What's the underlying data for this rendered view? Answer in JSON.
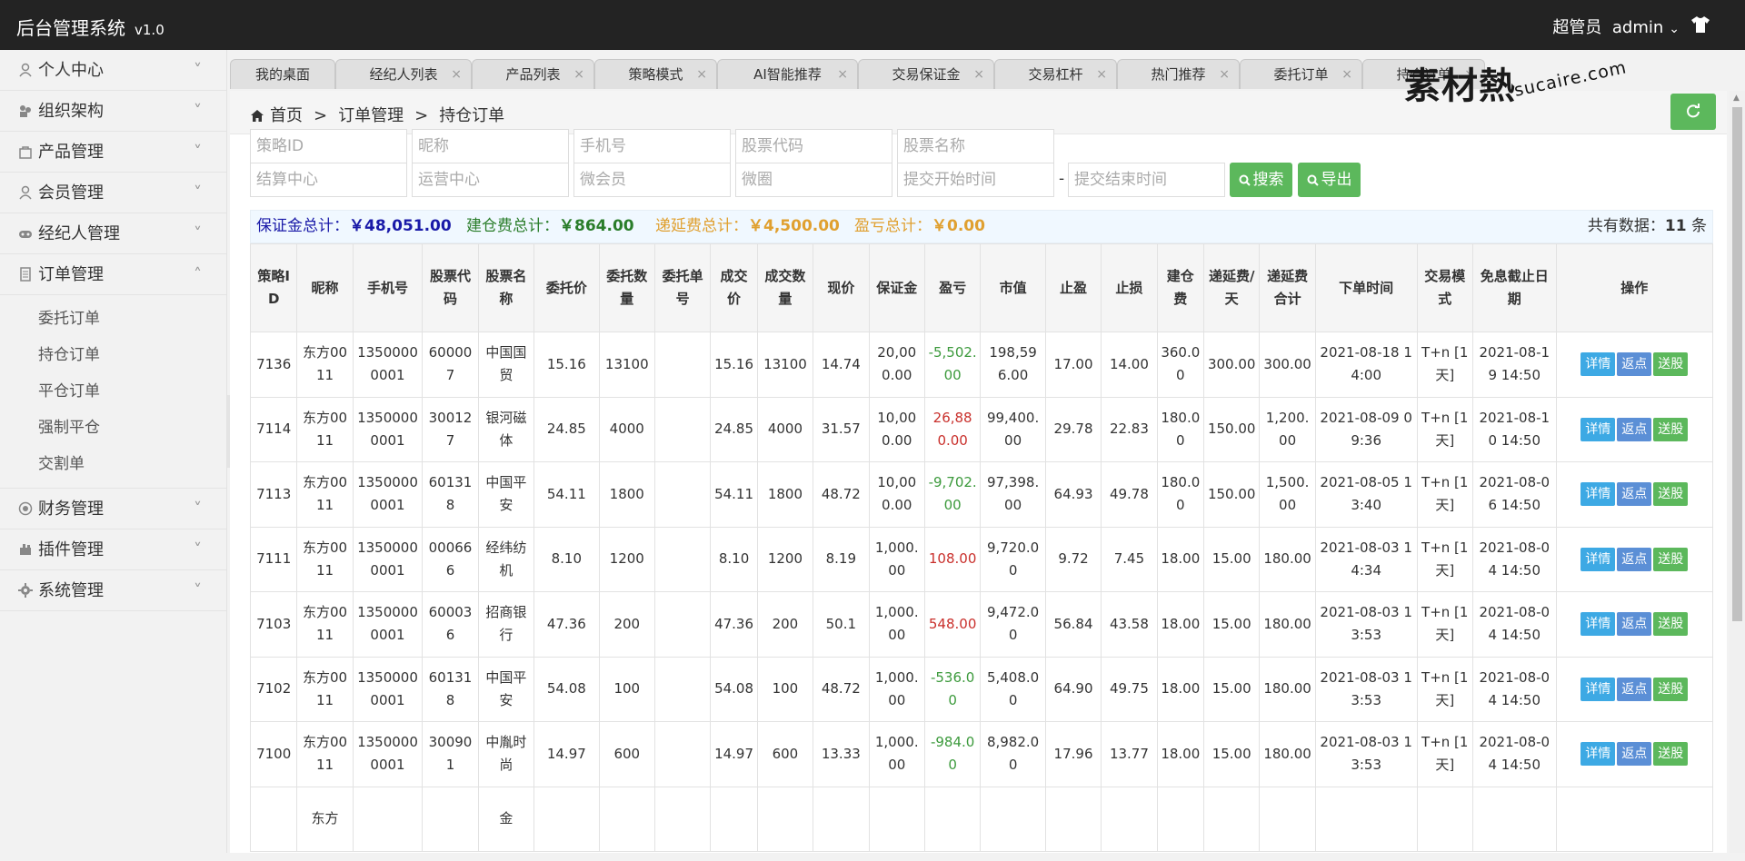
{
  "header": {
    "app_title": "后台管理系统",
    "version": "v1.0",
    "role": "超管员",
    "username": "admin"
  },
  "sidebar": {
    "items_top": [
      {
        "label": "个人中心",
        "icon": "user-icon"
      },
      {
        "label": "组织架构",
        "icon": "org-icon"
      },
      {
        "label": "产品管理",
        "icon": "bag-icon"
      },
      {
        "label": "会员管理",
        "icon": "member-icon"
      },
      {
        "label": "经纪人管理",
        "icon": "gamepad-icon"
      },
      {
        "label": "订单管理",
        "icon": "document-icon"
      }
    ],
    "sub_items": [
      "委托订单",
      "持仓订单",
      "平仓订单",
      "强制平仓",
      "交割单"
    ],
    "items_bottom": [
      {
        "label": "财务管理",
        "icon": "finance-icon"
      },
      {
        "label": "插件管理",
        "icon": "plugin-icon"
      },
      {
        "label": "系统管理",
        "icon": "gear-icon"
      }
    ]
  },
  "tabs": [
    "我的桌面",
    "经纪人列表",
    "产品列表",
    "策略模式",
    "AI智能推荐",
    "交易保证金",
    "交易杠杆",
    "热门推荐",
    "委托订单",
    "持仓订单"
  ],
  "watermark": {
    "big": "素材熱",
    "small": "sucaire.com"
  },
  "breadcrumb": {
    "home": "首页",
    "sep": ">",
    "level1": "订单管理",
    "level2": "持仓订单"
  },
  "filters": {
    "strategy_id": "策略ID",
    "nickname": "昵称",
    "phone": "手机号",
    "stock_code": "股票代码",
    "stock_name": "股票名称",
    "settle_center": "结算中心",
    "ops_center": "运营中心",
    "micro_member": "微会员",
    "micro_circle": "微圈",
    "start_time": "提交开始时间",
    "end_time": "提交结束时间",
    "dash": "-",
    "search_label": "搜索",
    "export_label": "导出"
  },
  "summary": {
    "margin_label": "保证金总计：",
    "margin_value": "￥48,051.00",
    "margin_color": "#1a1aa8",
    "open_fee_label": "建仓费总计：",
    "open_fee_value": "￥864.00",
    "open_fee_color": "#2a7d2a",
    "deferred_label": "递延费总计：",
    "deferred_value": "￥4,500.00",
    "deferred_color": "#e0a030",
    "pnl_label": "盈亏总计：",
    "pnl_value": "￥0.00",
    "pnl_color": "#e0a030",
    "total_prefix": "共有数据：",
    "total_count": "11",
    "total_suffix": "条"
  },
  "table": {
    "columns": [
      "策略ID",
      "昵称",
      "手机号",
      "股票代码",
      "股票名称",
      "委托价",
      "委托数量",
      "委托单号",
      "成交价",
      "成交数量",
      "现价",
      "保证金",
      "盈亏",
      "市值",
      "止盈",
      "止损",
      "建仓费",
      "递延费/天",
      "递延费合计",
      "下单时间",
      "交易模式",
      "免息截止日期",
      "操作"
    ],
    "actions": {
      "detail": "详情",
      "rebate": "返点",
      "gift": "送股"
    },
    "rows": [
      [
        "7136",
        "东方0011",
        "13500000001",
        "600007",
        "中国国贸",
        "15.16",
        "13100",
        "",
        "15.16",
        "13100",
        "14.74",
        "20,000.00",
        "-5,502.00",
        "198,596.00",
        "17.00",
        "14.00",
        "360.00",
        "300.00",
        "300.00",
        "2021-08-18 14:00",
        "T+n [1天]",
        "2021-08-19 14:50"
      ],
      [
        "7114",
        "东方0011",
        "13500000001",
        "300127",
        "银河磁体",
        "24.85",
        "4000",
        "",
        "24.85",
        "4000",
        "31.57",
        "10,000.00",
        "26,880.00",
        "99,400.00",
        "29.78",
        "22.83",
        "180.00",
        "150.00",
        "1,200.00",
        "2021-08-09 09:36",
        "T+n [1天]",
        "2021-08-10 14:50"
      ],
      [
        "7113",
        "东方0011",
        "13500000001",
        "601318",
        "中国平安",
        "54.11",
        "1800",
        "",
        "54.11",
        "1800",
        "48.72",
        "10,000.00",
        "-9,702.00",
        "97,398.00",
        "64.93",
        "49.78",
        "180.00",
        "150.00",
        "1,500.00",
        "2021-08-05 13:40",
        "T+n [1天]",
        "2021-08-06 14:50"
      ],
      [
        "7111",
        "东方0011",
        "13500000001",
        "000666",
        "经纬纺机",
        "8.10",
        "1200",
        "",
        "8.10",
        "1200",
        "8.19",
        "1,000.00",
        "108.00",
        "9,720.00",
        "9.72",
        "7.45",
        "18.00",
        "15.00",
        "180.00",
        "2021-08-03 14:34",
        "T+n [1天]",
        "2021-08-04 14:50"
      ],
      [
        "7103",
        "东方0011",
        "13500000001",
        "600036",
        "招商银行",
        "47.36",
        "200",
        "",
        "47.36",
        "200",
        "50.1",
        "1,000.00",
        "548.00",
        "9,472.00",
        "56.84",
        "43.58",
        "18.00",
        "15.00",
        "180.00",
        "2021-08-03 13:53",
        "T+n [1天]",
        "2021-08-04 14:50"
      ],
      [
        "7102",
        "东方0011",
        "13500000001",
        "601318",
        "中国平安",
        "54.08",
        "100",
        "",
        "54.08",
        "100",
        "48.72",
        "1,000.00",
        "-536.00",
        "5,408.00",
        "64.90",
        "49.75",
        "18.00",
        "15.00",
        "180.00",
        "2021-08-03 13:53",
        "T+n [1天]",
        "2021-08-04 14:50"
      ],
      [
        "7100",
        "东方0011",
        "13500000001",
        "300901",
        "中胤时尚",
        "14.97",
        "600",
        "",
        "14.97",
        "600",
        "13.33",
        "1,000.00",
        "-984.00",
        "8,982.00",
        "17.96",
        "13.77",
        "18.00",
        "15.00",
        "180.00",
        "2021-08-03 13:53",
        "T+n [1天]",
        "2021-08-04 14:50"
      ],
      [
        "",
        "东方",
        "",
        "",
        "金",
        "",
        "",
        "",
        "",
        "",
        "",
        "",
        "",
        "",
        "",
        "",
        "",
        "",
        "",
        "",
        "",
        ""
      ]
    ]
  },
  "colors": {
    "accent_green": "#5cb85c",
    "loss_green": "#3c9a3c",
    "profit_red": "#c9302c",
    "header_bg": "#232323"
  }
}
